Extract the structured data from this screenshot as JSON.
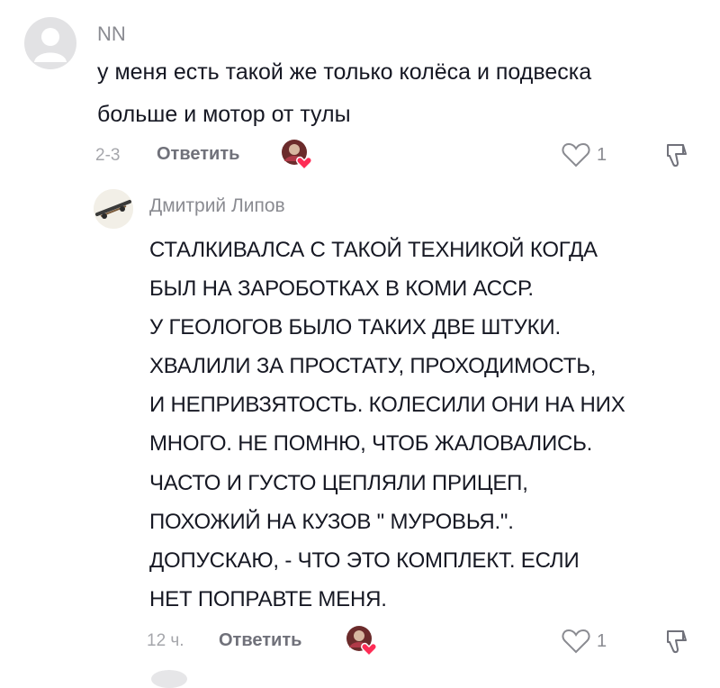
{
  "comments": [
    {
      "username": "NN",
      "text": [
        "у меня есть такой же только колёса и подвеска",
        "больше и мотор от тулы"
      ],
      "time": "2-3",
      "reply_label": "Ответить",
      "likes": "1"
    },
    {
      "username": "Дмитрий Липов",
      "text": [
        "СТАЛКИВАЛСА С ТАКОЙ ТЕХНИКОЙ КОГДА",
        "БЫЛ НА ЗАРОБОТКАХ В КОМИ АССР.",
        "У ГЕОЛОГОВ БЫЛО ТАКИХ ДВЕ ШТУКИ.",
        "ХВАЛИЛИ ЗА ПРОСТАТУ, ПРОХОДИМОСТЬ,",
        "И НЕПРИВЗЯТОСТЬ. КОЛЕСИЛИ ОНИ НА НИХ",
        "МНОГО. НЕ ПОМНЮ, ЧТОБ ЖАЛОВАЛИСЬ.",
        "ЧАСТО И ГУСТО ЦЕПЛЯЛИ ПРИЦЕП,",
        "ПОХОЖИЙ НА КУЗОВ \" МУРОВЬЯ.\".",
        "ДОПУСКАЮ, - ЧТО ЭТО КОМПЛЕКТ. ЕСЛИ",
        "НЕТ ПОПРАВТЕ МЕНЯ."
      ],
      "time": "12 ч.",
      "reply_label": "Ответить",
      "likes": "1"
    }
  ],
  "colors": {
    "heart_badge": "#fe2c55",
    "text": "#161823",
    "muted": "#8a8b91"
  }
}
